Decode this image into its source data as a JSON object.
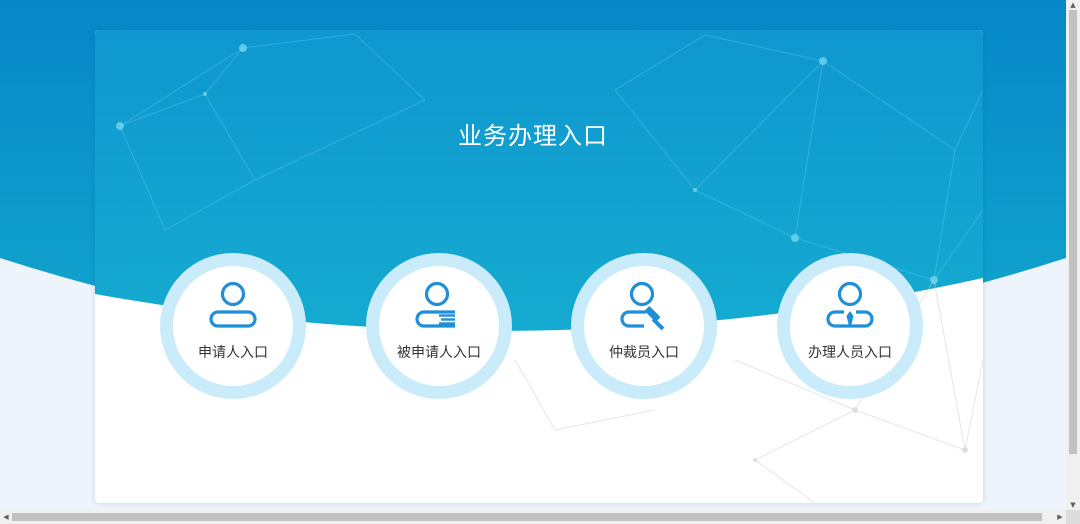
{
  "page": {
    "title": "业务办理入口"
  },
  "entries": [
    {
      "label": "申请人入口",
      "icon": "applicant-icon"
    },
    {
      "label": "被申请人入口",
      "icon": "respondent-icon"
    },
    {
      "label": "仲裁员入口",
      "icon": "arbitrator-icon"
    },
    {
      "label": "办理人员入口",
      "icon": "staff-icon"
    }
  ],
  "colors": {
    "banner_top": "#0a86c8",
    "banner_bottom": "#11a9cf",
    "page_bg": "#eef4fb",
    "ring": "#c9ebfa",
    "icon": "#1e8fd8",
    "label": "#333333"
  }
}
